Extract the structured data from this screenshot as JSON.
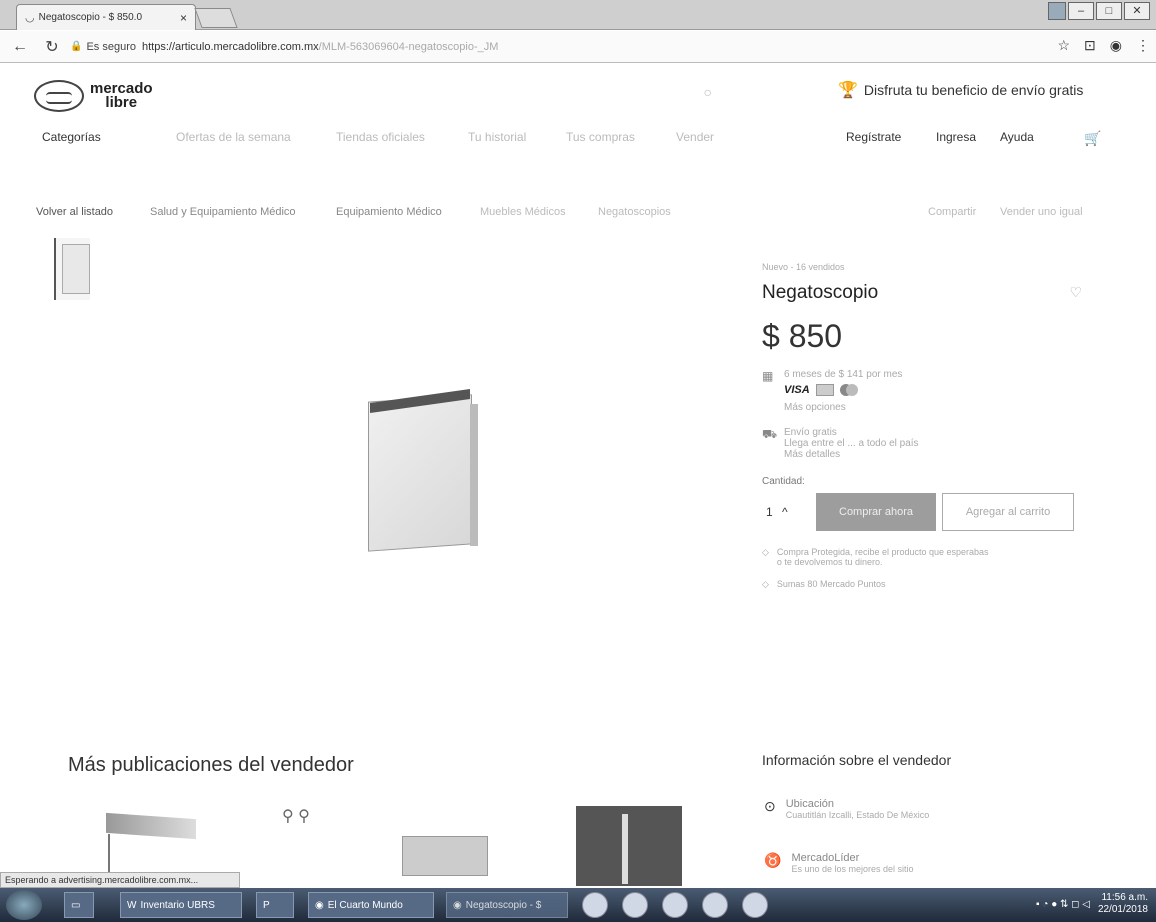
{
  "browser": {
    "tab_title": "Negatoscopio - $ 850.0",
    "tab_close": "×",
    "user_label": "",
    "secure_label": "Es seguro",
    "url_main": "https://articulo.mercadolibre.com.mx",
    "url_rest": "/MLM-563069604-negatoscopio-_JM",
    "status_text": "Esperando a advertising.mercadolibre.com.mx..."
  },
  "site": {
    "logo_line1": "mercado",
    "logo_line2": "libre",
    "promo": "Disfruta tu beneficio de envío gratis"
  },
  "nav": {
    "categorias": "Categorías",
    "ofertas": "Ofertas de la semana",
    "tiendas": "Tiendas oficiales",
    "historial": "Tu historial",
    "compras": "Tus compras",
    "vender": "Vender",
    "registrate": "Regístrate",
    "ingresa": "Ingresa",
    "ayuda": "Ayuda"
  },
  "breadcrumbs": {
    "back": "Volver al listado",
    "c1": "Salud y Equipamiento Médico",
    "c2": "Equipamiento Médico",
    "c3": "Muebles Médicos",
    "c4": "Negatoscopios",
    "share": "Compartir",
    "sell_similar": "Vender uno igual"
  },
  "product": {
    "status": "Nuevo - 16 vendidos",
    "title": "Negatoscopio",
    "price": "$ 850",
    "installments": "6 meses de $ 141 por mes",
    "card_visa": "VISA",
    "more_options": "Más opciones",
    "shipping_title": "Envío gratis",
    "shipping_sub": "Llega entre el ... a todo el país",
    "shipping_sub2": "Más detalles",
    "qty_label": "Cantidad:",
    "qty_value": "1",
    "buy_button": "Comprar ahora",
    "cart_button": "Agregar al carrito",
    "benefit1": "Compra Protegida, recibe el producto que esperabas",
    "benefit1b": "o te devolvemos tu dinero.",
    "benefit2": "Sumas 80 Mercado Puntos"
  },
  "sections": {
    "more_pubs": "Más publicaciones del vendedor",
    "seller_info": "Información sobre el vendedor",
    "location_label": "Ubicación",
    "location_value": "Cuautitlán Izcalli, Estado De México",
    "leader_label": "MercadoLíder",
    "leader_value": "Es uno de los mejores del sitio"
  },
  "taskbar": {
    "item1": "Inventario UBRS",
    "item2": "El Cuarto Mundo",
    "item3": "Negatoscopio - $",
    "time": "11:56 a.m.",
    "date": "22/01/2018"
  },
  "colors": {
    "buy_button_bg": "#9d9d9d",
    "taskbar": "#2b3a52"
  }
}
